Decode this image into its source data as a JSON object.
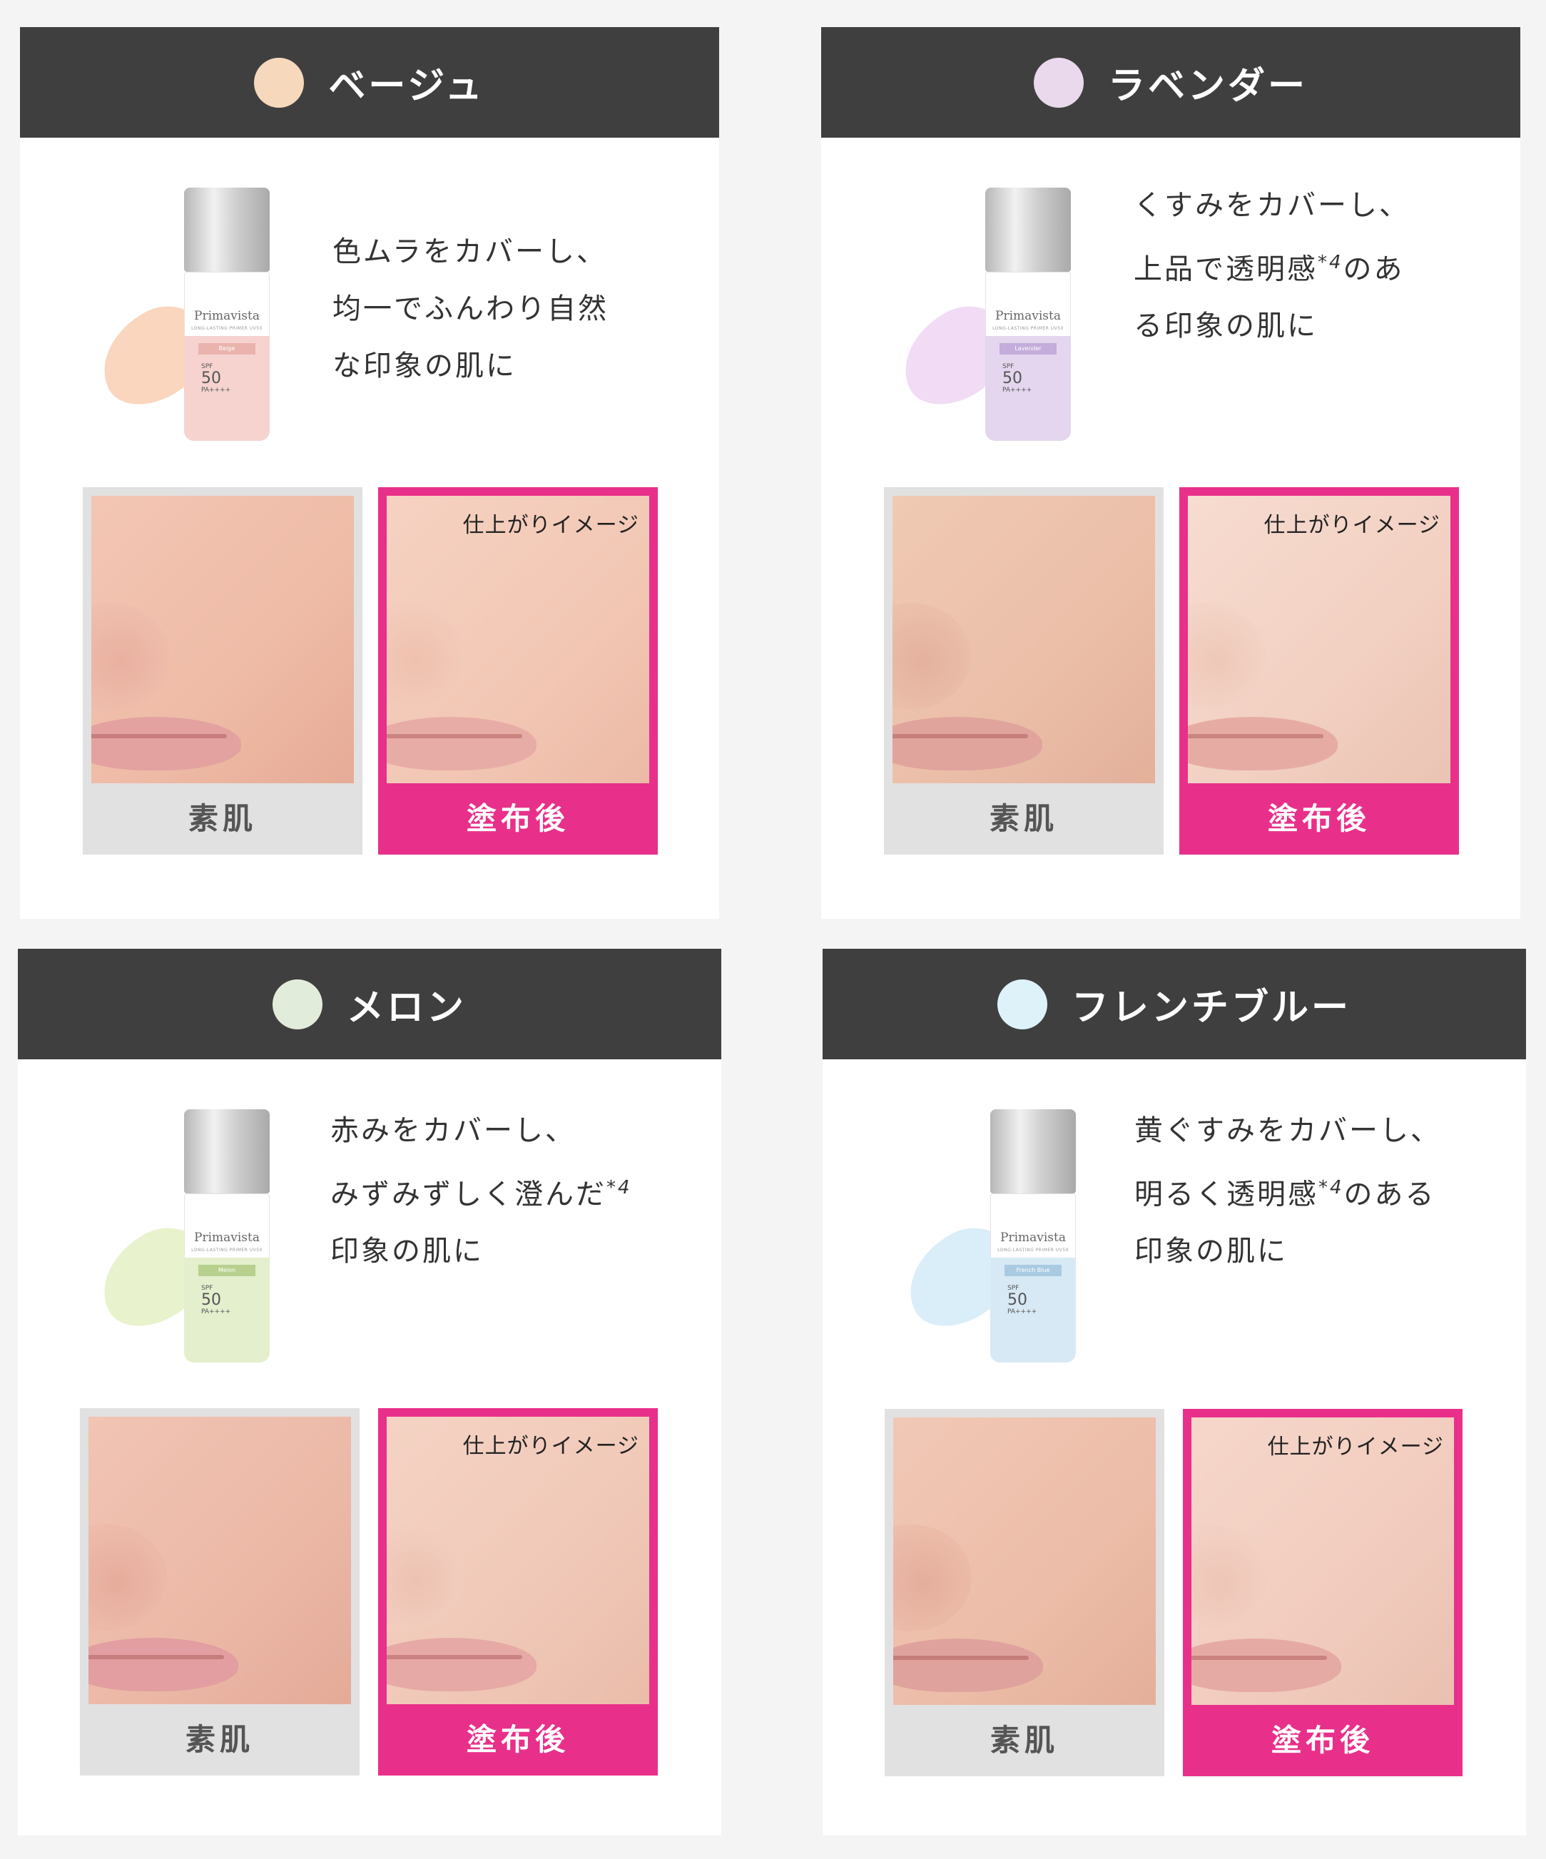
{
  "cards": [
    {
      "title": "ベージュ",
      "swatch_color": "#f6d8bd",
      "desc_lines": [
        "色ムラをカバーし、",
        "均一でふんわり自然",
        "な印象の肌に"
      ],
      "bottle": {
        "brand": "Primavista",
        "line": "LONG-LASTING PRIMER UV50",
        "shade": "Beige",
        "spf": "SPF",
        "spf_value": "50",
        "pa": "PA++++",
        "color": "#f6d3cf",
        "smear": "#f8d2b6"
      },
      "before_label": "素肌",
      "after_label": "塗布後",
      "after_caption": "仕上がりイメージ"
    },
    {
      "title": "ラベンダー",
      "swatch_color": "#ead9ec",
      "desc_lines": [
        "くすみをカバーし、",
        "上品で透明感",
        "る印象の肌に"
      ],
      "desc_sup": "*4",
      "desc_line2_suffix": "のあ",
      "bottle": {
        "brand": "Primavista",
        "line": "LONG-LASTING PRIMER UV50",
        "shade": "Lavender",
        "spf": "SPF",
        "spf_value": "50",
        "pa": "PA++++",
        "color": "#e3d6ee",
        "smear": "#efd7f4"
      },
      "before_label": "素肌",
      "after_label": "塗布後",
      "after_caption": "仕上がりイメージ"
    },
    {
      "title": "メロン",
      "swatch_color": "#e2ecda",
      "desc_lines": [
        "赤みをカバーし、",
        "みずみずしく澄んだ",
        "印象の肌に"
      ],
      "desc_sup": "*4",
      "bottle": {
        "brand": "Primavista",
        "line": "LONG-LASTING PRIMER UV50",
        "shade": "Melon",
        "spf": "SPF",
        "spf_value": "50",
        "pa": "PA++++",
        "color": "#e4efce",
        "smear": "#e6f1c6"
      },
      "before_label": "素肌",
      "after_label": "塗布後",
      "after_caption": "仕上がりイメージ"
    },
    {
      "title": "フレンチブルー",
      "swatch_color": "#def2fa",
      "desc_lines": [
        "黄ぐすみをカバーし、",
        "明るく透明感",
        "印象の肌に"
      ],
      "desc_sup": "*4",
      "desc_line2_suffix": "のある",
      "bottle": {
        "brand": "Primavista",
        "line": "LONG-LASTING PRIMER UV50",
        "shade": "French Blue",
        "spf": "SPF",
        "spf_value": "50",
        "pa": "PA++++",
        "color": "#d7e9f5",
        "smear": "#d6ecf8"
      },
      "before_label": "素肌",
      "after_label": "塗布後",
      "after_caption": "仕上がりイメージ"
    }
  ],
  "colors": {
    "header_bg": "#3f3f3f",
    "accent_pink": "#e8308a",
    "before_bg": "#e1e1e1"
  }
}
